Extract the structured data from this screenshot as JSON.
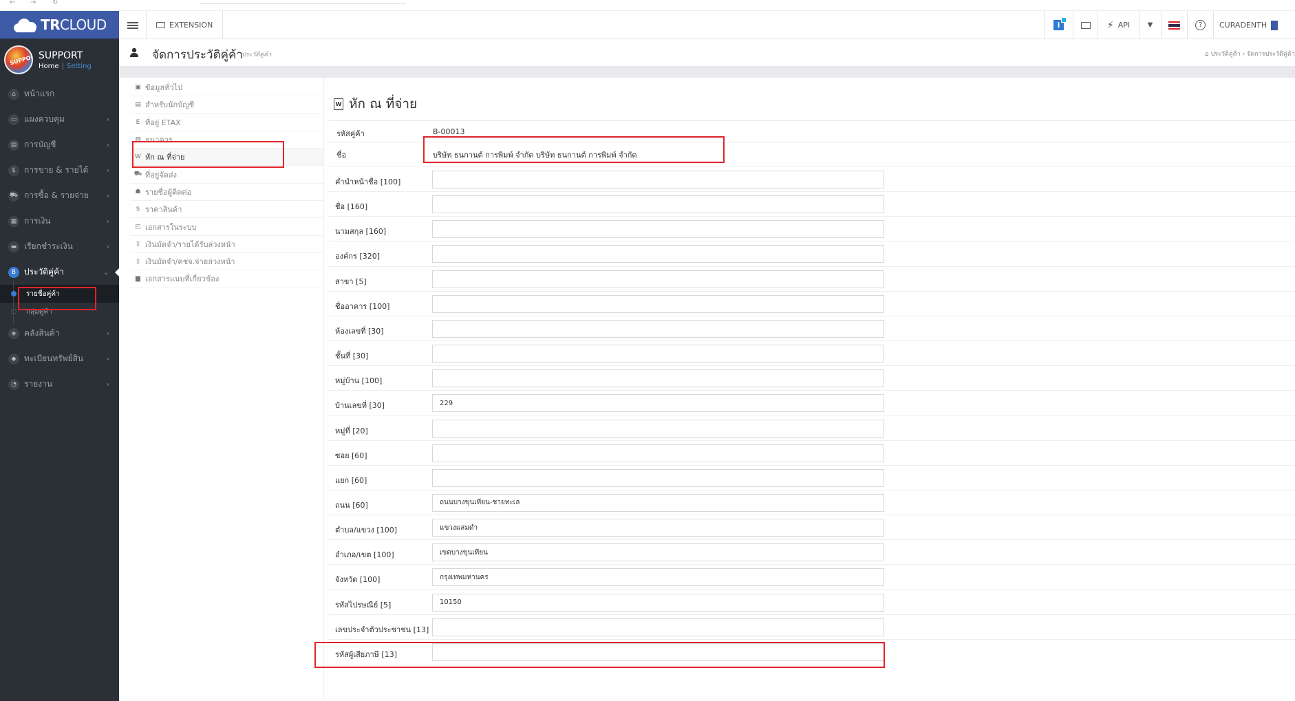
{
  "app": {
    "brand_bold": "TR",
    "brand_light": "CLOUD"
  },
  "user": {
    "name": "SUPPORT",
    "home_link": "Home",
    "separator": "|",
    "setting_link": "Setting",
    "avatar_text": "SUPPORT"
  },
  "sidebar": {
    "items": [
      {
        "label": "หน้าแรก",
        "icon": "home-icon",
        "glyph": "⌂",
        "chevron": false
      },
      {
        "label": "แผงควบคุม",
        "icon": "monitor-icon",
        "glyph": "▭",
        "chevron": true
      },
      {
        "label": "การบัญชี",
        "icon": "book-icon",
        "glyph": "▤",
        "chevron": true
      },
      {
        "label": "การขาย & รายได้",
        "icon": "dollar-icon",
        "glyph": "$",
        "chevron": true
      },
      {
        "label": "การซื้อ & รายจ่าย",
        "icon": "cart-icon",
        "glyph": "⛟",
        "chevron": true
      },
      {
        "label": "การเงิน",
        "icon": "wallet-icon",
        "glyph": "▦",
        "chevron": true
      },
      {
        "label": "เรียกชำระเงิน",
        "icon": "card-icon",
        "glyph": "▬",
        "chevron": true
      },
      {
        "label": "ประวัติคู่ค้า",
        "icon": "contacts-icon",
        "glyph": "B",
        "chevron": true,
        "active": true
      },
      {
        "label": "คลังสินค้า",
        "icon": "boxes-icon",
        "glyph": "◈",
        "chevron": true
      },
      {
        "label": "ทะเบียนทรัพย์สิน",
        "icon": "diamond-icon",
        "glyph": "◆",
        "chevron": true
      },
      {
        "label": "รายงาน",
        "icon": "chart-icon",
        "glyph": "◔",
        "chevron": true
      }
    ],
    "sub_items": [
      {
        "label": "รายชื่อคู่ค้า",
        "selected": true
      },
      {
        "label": "กลุ่มคู่ค้า",
        "selected": false
      }
    ],
    "chevron_glyph": "›",
    "chevron_down_glyph": "⌄"
  },
  "topbar": {
    "extension_label": "EXTENSION",
    "info_label": "i",
    "api_label": "API",
    "help_glyph": "?",
    "user_label": "CURADENTH"
  },
  "page": {
    "title": "จัดการประวัติคู่ค้า",
    "subtitle": "ประวัติคู่ค้า",
    "breadcrumb": "⌂  ประวัติคู่ค้า  ›  จัดการประวัติคู่ค้า"
  },
  "sub_menu": [
    {
      "label": "ข้อมูลทั่วไป",
      "glyph": "▣"
    },
    {
      "label": "สำหรับนักบัญชี",
      "glyph": "▤"
    },
    {
      "label": "ที่อยู่ ETAX",
      "glyph": "E"
    },
    {
      "label": "ธนาคาร",
      "glyph": "▥"
    },
    {
      "label": "หัก ณ ที่จ่าย",
      "glyph": "W",
      "active": true
    },
    {
      "label": "ที่อยู่จัดส่ง",
      "glyph": "⛟"
    },
    {
      "label": "รายชื่อผู้ติดต่อ",
      "glyph": "☗"
    },
    {
      "label": "ราคาสินค้า",
      "glyph": "$"
    },
    {
      "label": "เอกสารในระบบ",
      "glyph": "◰"
    },
    {
      "label": "เงินมัดจำ/รายได้รับล่วงหน้า",
      "glyph": "▯"
    },
    {
      "label": "เงินมัดจำ/คชจ.จ่ายล่วงหน้า",
      "glyph": "▯"
    },
    {
      "label": "เอกสารแนบที่เกี่ยวข้อง",
      "glyph": "▆"
    }
  ],
  "form": {
    "title": "หัก ณ ที่จ่าย",
    "title_icon_glyph": "W",
    "code_label": "รหัสคู่ค้า",
    "code_value": "B-00013",
    "name_label": "ชื่อ",
    "name_value": "บริษัท ธนกานต์ การพิมพ์ จำกัด บริษัท ธนกานต์ การพิมพ์ จำกัด",
    "fields": [
      {
        "label": "คำนำหน้าชื่อ [100]",
        "value": ""
      },
      {
        "label": "ชื่อ [160]",
        "value": ""
      },
      {
        "label": "นามสกุล [160]",
        "value": ""
      },
      {
        "label": "องค์กร [320]",
        "value": ""
      },
      {
        "label": "สาขา [5]",
        "value": ""
      },
      {
        "label": "ชื่ออาคาร [100]",
        "value": ""
      },
      {
        "label": "ห้องเลขที่ [30]",
        "value": ""
      },
      {
        "label": "ชั้นที่ [30]",
        "value": ""
      },
      {
        "label": "หมู่บ้าน [100]",
        "value": ""
      },
      {
        "label": "บ้านเลขที่ [30]",
        "value": "229"
      },
      {
        "label": "หมู่ที่ [20]",
        "value": ""
      },
      {
        "label": "ซอย [60]",
        "value": ""
      },
      {
        "label": "แยก [60]",
        "value": ""
      },
      {
        "label": "ถนน [60]",
        "value": "ถนนบางขุนเทียน-ชายทะเล"
      },
      {
        "label": "ตำบล/แขวง [100]",
        "value": "แขวงแสมดำ"
      },
      {
        "label": "อำเภอ/เขต [100]",
        "value": "เขตบางขุนเทียน"
      },
      {
        "label": "จังหวัด [100]",
        "value": "กรุงเทพมหานคร"
      },
      {
        "label": "รหัสไปรษณีย์ [5]",
        "value": "10150"
      },
      {
        "label": "เลขประจำตัวประชาชน [13]",
        "value": ""
      },
      {
        "label": "รหัสผู้เสียภาษี [13]",
        "value": ""
      }
    ]
  },
  "colors": {
    "brand_blue": "#3c5aa5",
    "sidebar_bg": "#2b3036",
    "highlight_red": "#e1242a",
    "active_blue": "#3a7bd5"
  }
}
